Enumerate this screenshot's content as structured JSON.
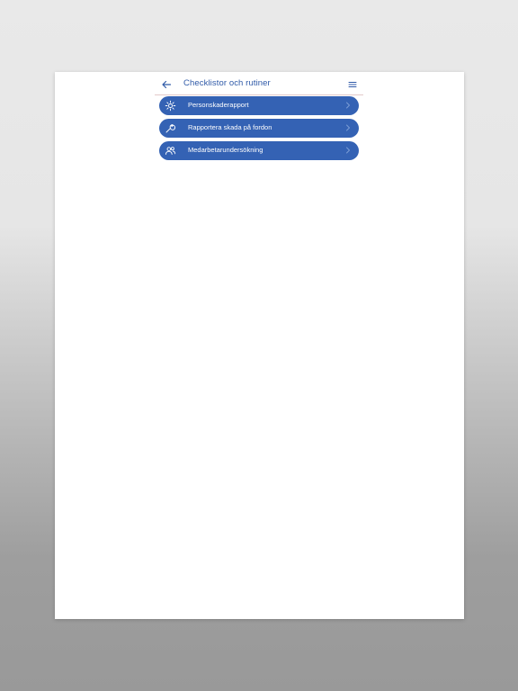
{
  "header": {
    "title": "Checklistor och rutiner",
    "back_icon": "arrow-left-icon",
    "menu_icon": "menu-lines-icon"
  },
  "items": [
    {
      "label": "Personskaderapport",
      "icon": "gear-icon"
    },
    {
      "label": "Rapportera skada på fordon",
      "icon": "wrench-icon"
    },
    {
      "label": "Medarbetarundersökning",
      "icon": "users-icon"
    }
  ],
  "colors": {
    "accent": "#3462b4",
    "title": "#2f5aa8",
    "divider": "#e3c9c9"
  }
}
